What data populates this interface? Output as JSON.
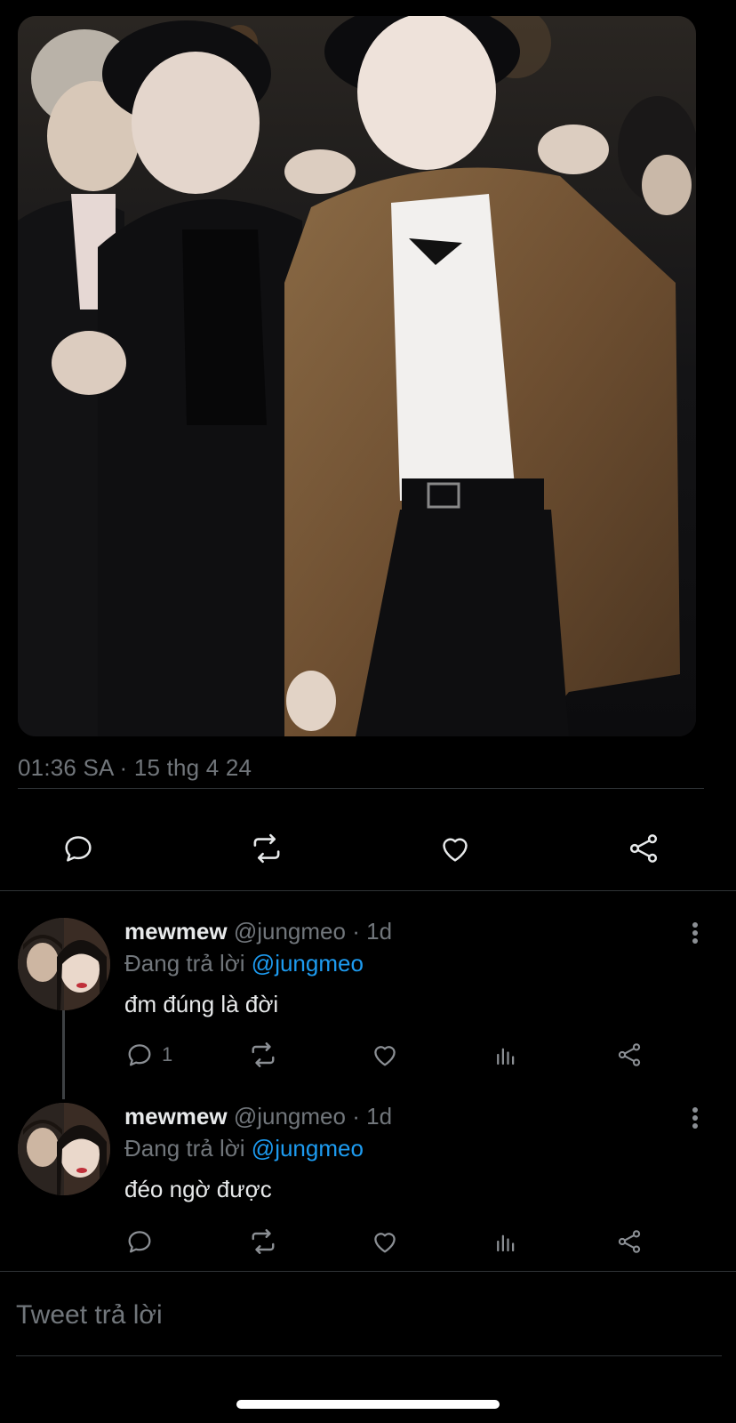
{
  "tweet": {
    "timestamp": "01:36 SA · 15 thg 4 24"
  },
  "actions": {
    "icons": [
      "reply-icon",
      "retweet-icon",
      "like-icon",
      "share-icon"
    ]
  },
  "replies": [
    {
      "name": "mewmew",
      "handle": "@jungmeo",
      "separator": "·",
      "age": "1d",
      "replying_prefix": "Đang trả lời",
      "replying_to": "@jungmeo",
      "text": "đm đúng là đời",
      "reply_count": "1"
    },
    {
      "name": "mewmew",
      "handle": "@jungmeo",
      "separator": "·",
      "age": "1d",
      "replying_prefix": "Đang trả lời",
      "replying_to": "@jungmeo",
      "text": "đéo ngờ được",
      "reply_count": ""
    }
  ],
  "composer": {
    "placeholder": "Tweet trả lời"
  },
  "colors": {
    "background": "#000000",
    "text": "#e7e9ea",
    "muted": "#71767b",
    "link": "#1d9bf0",
    "divider": "#2f3336"
  }
}
